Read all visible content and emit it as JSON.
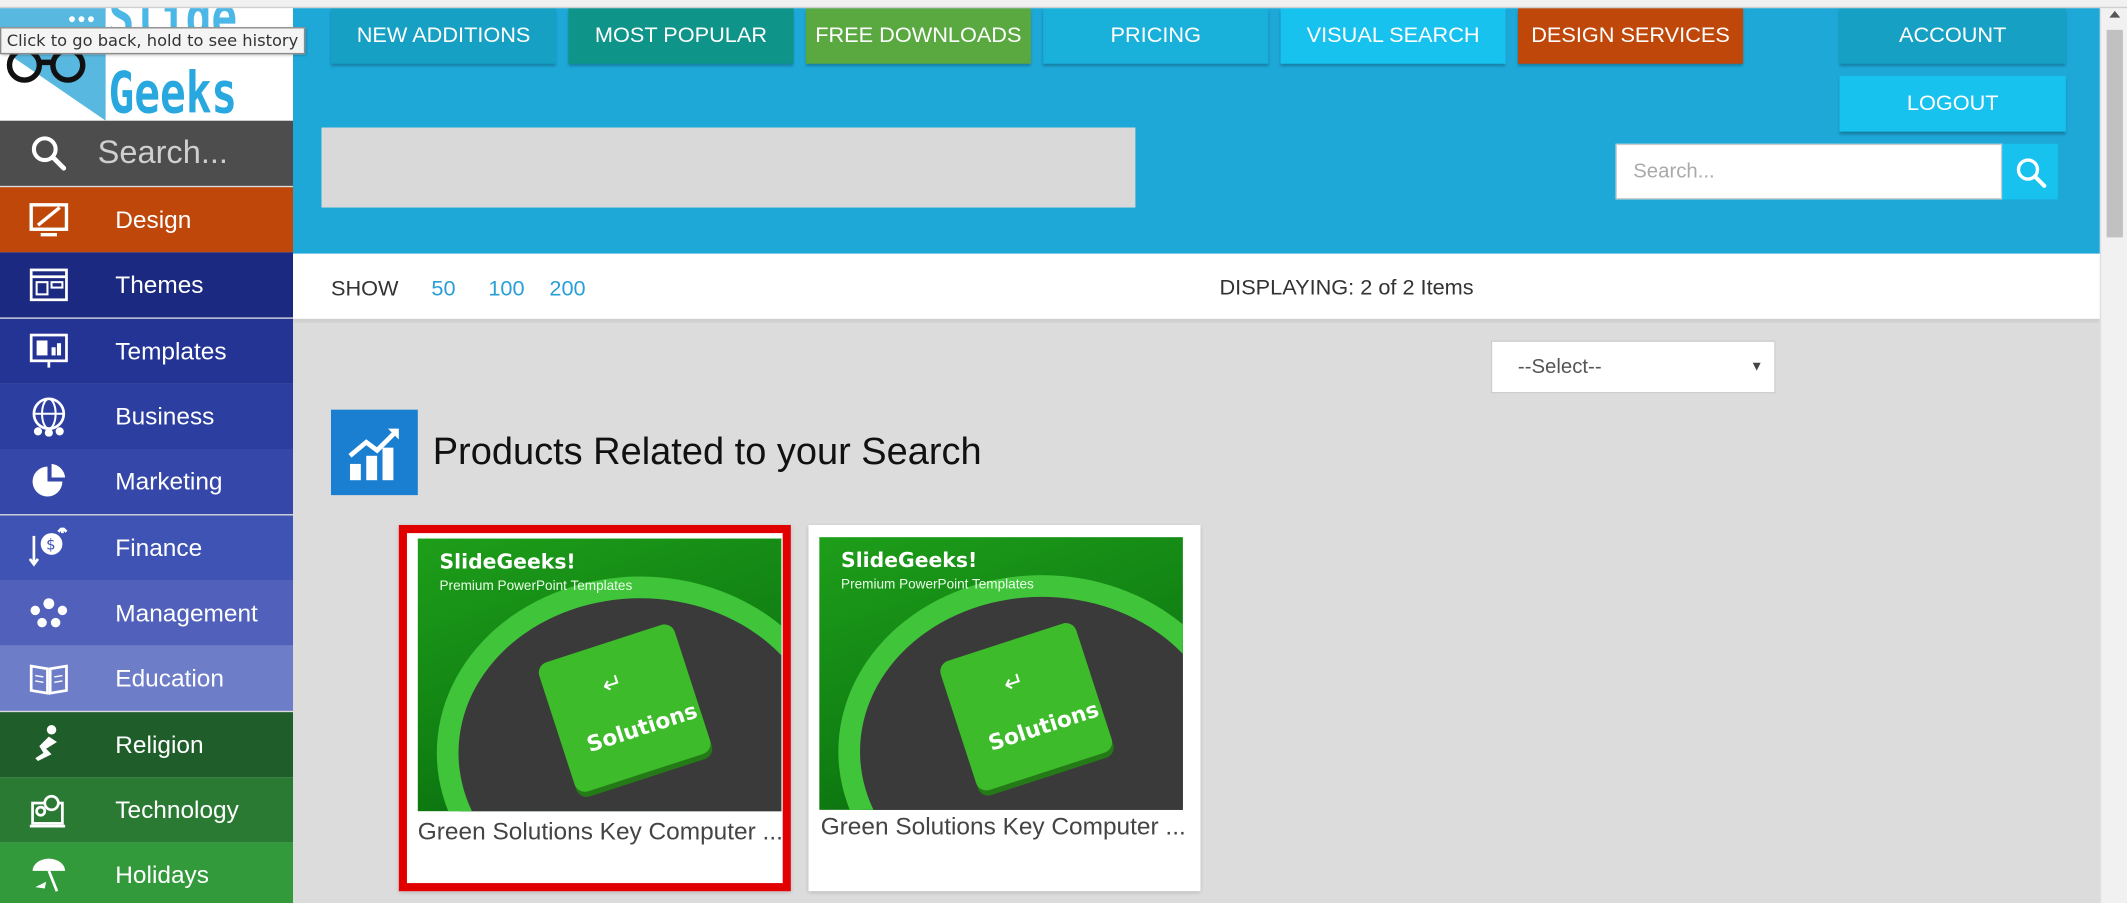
{
  "tooltip": "Click to go back, hold to see history",
  "logo": {
    "line1": "Slide",
    "line2": "Geeks"
  },
  "sidebar": {
    "search_placeholder": "Search...",
    "items": [
      {
        "label": "Design",
        "color": "#c0470a",
        "icon": "design-icon"
      },
      {
        "label": "Themes",
        "color": "#1b2a80",
        "icon": "themes-icon"
      },
      {
        "label": "Templates",
        "color": "#233495",
        "icon": "templates-icon"
      },
      {
        "label": "Business",
        "color": "#2c3ea0",
        "icon": "business-icon"
      },
      {
        "label": "Marketing",
        "color": "#3548aa",
        "icon": "marketing-icon"
      },
      {
        "label": "Finance",
        "color": "#3e53b3",
        "icon": "finance-icon"
      },
      {
        "label": "Management",
        "color": "#5060bb",
        "icon": "management-icon"
      },
      {
        "label": "Education",
        "color": "#6e7dc8",
        "icon": "education-icon"
      },
      {
        "label": "Religion",
        "color": "#1f5e2a",
        "icon": "religion-icon"
      },
      {
        "label": "Technology",
        "color": "#2a7a34",
        "icon": "technology-icon"
      },
      {
        "label": "Holidays",
        "color": "#339a3c",
        "icon": "holidays-icon"
      }
    ]
  },
  "nav": {
    "new_additions": "NEW ADDITIONS",
    "most_popular": "MOST POPULAR",
    "free_downloads": "FREE DOWNLOADS",
    "pricing": "PRICING",
    "visual_search": "VISUAL SEARCH",
    "design_services": "DESIGN SERVICES",
    "account": "ACCOUNT",
    "logout": "LOGOUT"
  },
  "header_search": {
    "placeholder": "Search..."
  },
  "showbar": {
    "show_label": "SHOW",
    "page_sizes": [
      "50",
      "100",
      "200"
    ],
    "displaying": "DISPLAYING: 2 of 2 Items"
  },
  "sort_select": {
    "value": "--Select--"
  },
  "section": {
    "title": "Products Related to your Search"
  },
  "products": [
    {
      "brand": "SlideGeeks!",
      "tagline": "Premium PowerPoint Templates",
      "key_label": "Solutions",
      "title": "Green Solutions Key Computer ..."
    },
    {
      "brand": "SlideGeeks!",
      "tagline": "Premium PowerPoint Templates",
      "key_label": "Solutions",
      "title": "Green Solutions Key Computer ..."
    }
  ],
  "colors": {
    "header_bg": "#1ea8d8",
    "selected_border": "#e00000"
  }
}
